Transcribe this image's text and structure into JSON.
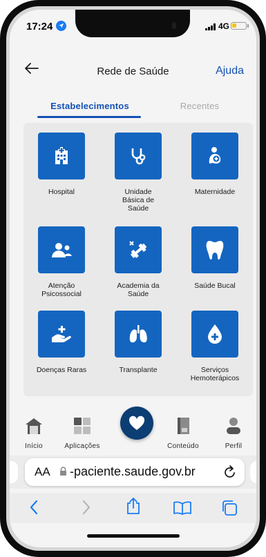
{
  "status_bar": {
    "time": "17:24",
    "network": "4G"
  },
  "header": {
    "title": "Rede de Saúde",
    "help_label": "Ajuda"
  },
  "tabs": [
    {
      "label": "Estabelecimentos",
      "active": true
    },
    {
      "label": "Recentes",
      "active": false
    }
  ],
  "tiles": [
    {
      "label": "Hospital",
      "icon": "hospital-icon"
    },
    {
      "label": "Unidade\nBásica de\nSaúde",
      "icon": "stethoscope-icon"
    },
    {
      "label": "Maternidade",
      "icon": "maternity-icon"
    },
    {
      "label": "Atenção\nPsicossocial",
      "icon": "people-icon"
    },
    {
      "label": "Academia da\nSaúde",
      "icon": "dumbbell-icon"
    },
    {
      "label": "Saúde Bucal",
      "icon": "tooth-icon"
    },
    {
      "label": "Doenças Raras",
      "icon": "hand-plus-icon"
    },
    {
      "label": "Transplante",
      "icon": "lungs-icon"
    },
    {
      "label": "Serviços\nHemoterápicos",
      "icon": "blood-drop-icon"
    }
  ],
  "bottom_nav": {
    "inicio": "Início",
    "aplicacoes": "Aplicações",
    "conteudo": "Conteúdo",
    "perfil": "Perfil"
  },
  "browser": {
    "aa_label": "AA",
    "url": "-paciente.saude.gov.br"
  },
  "colors": {
    "primary": "#1351b4",
    "tile_blue": "#1465c0",
    "fab": "#0c3d73"
  }
}
